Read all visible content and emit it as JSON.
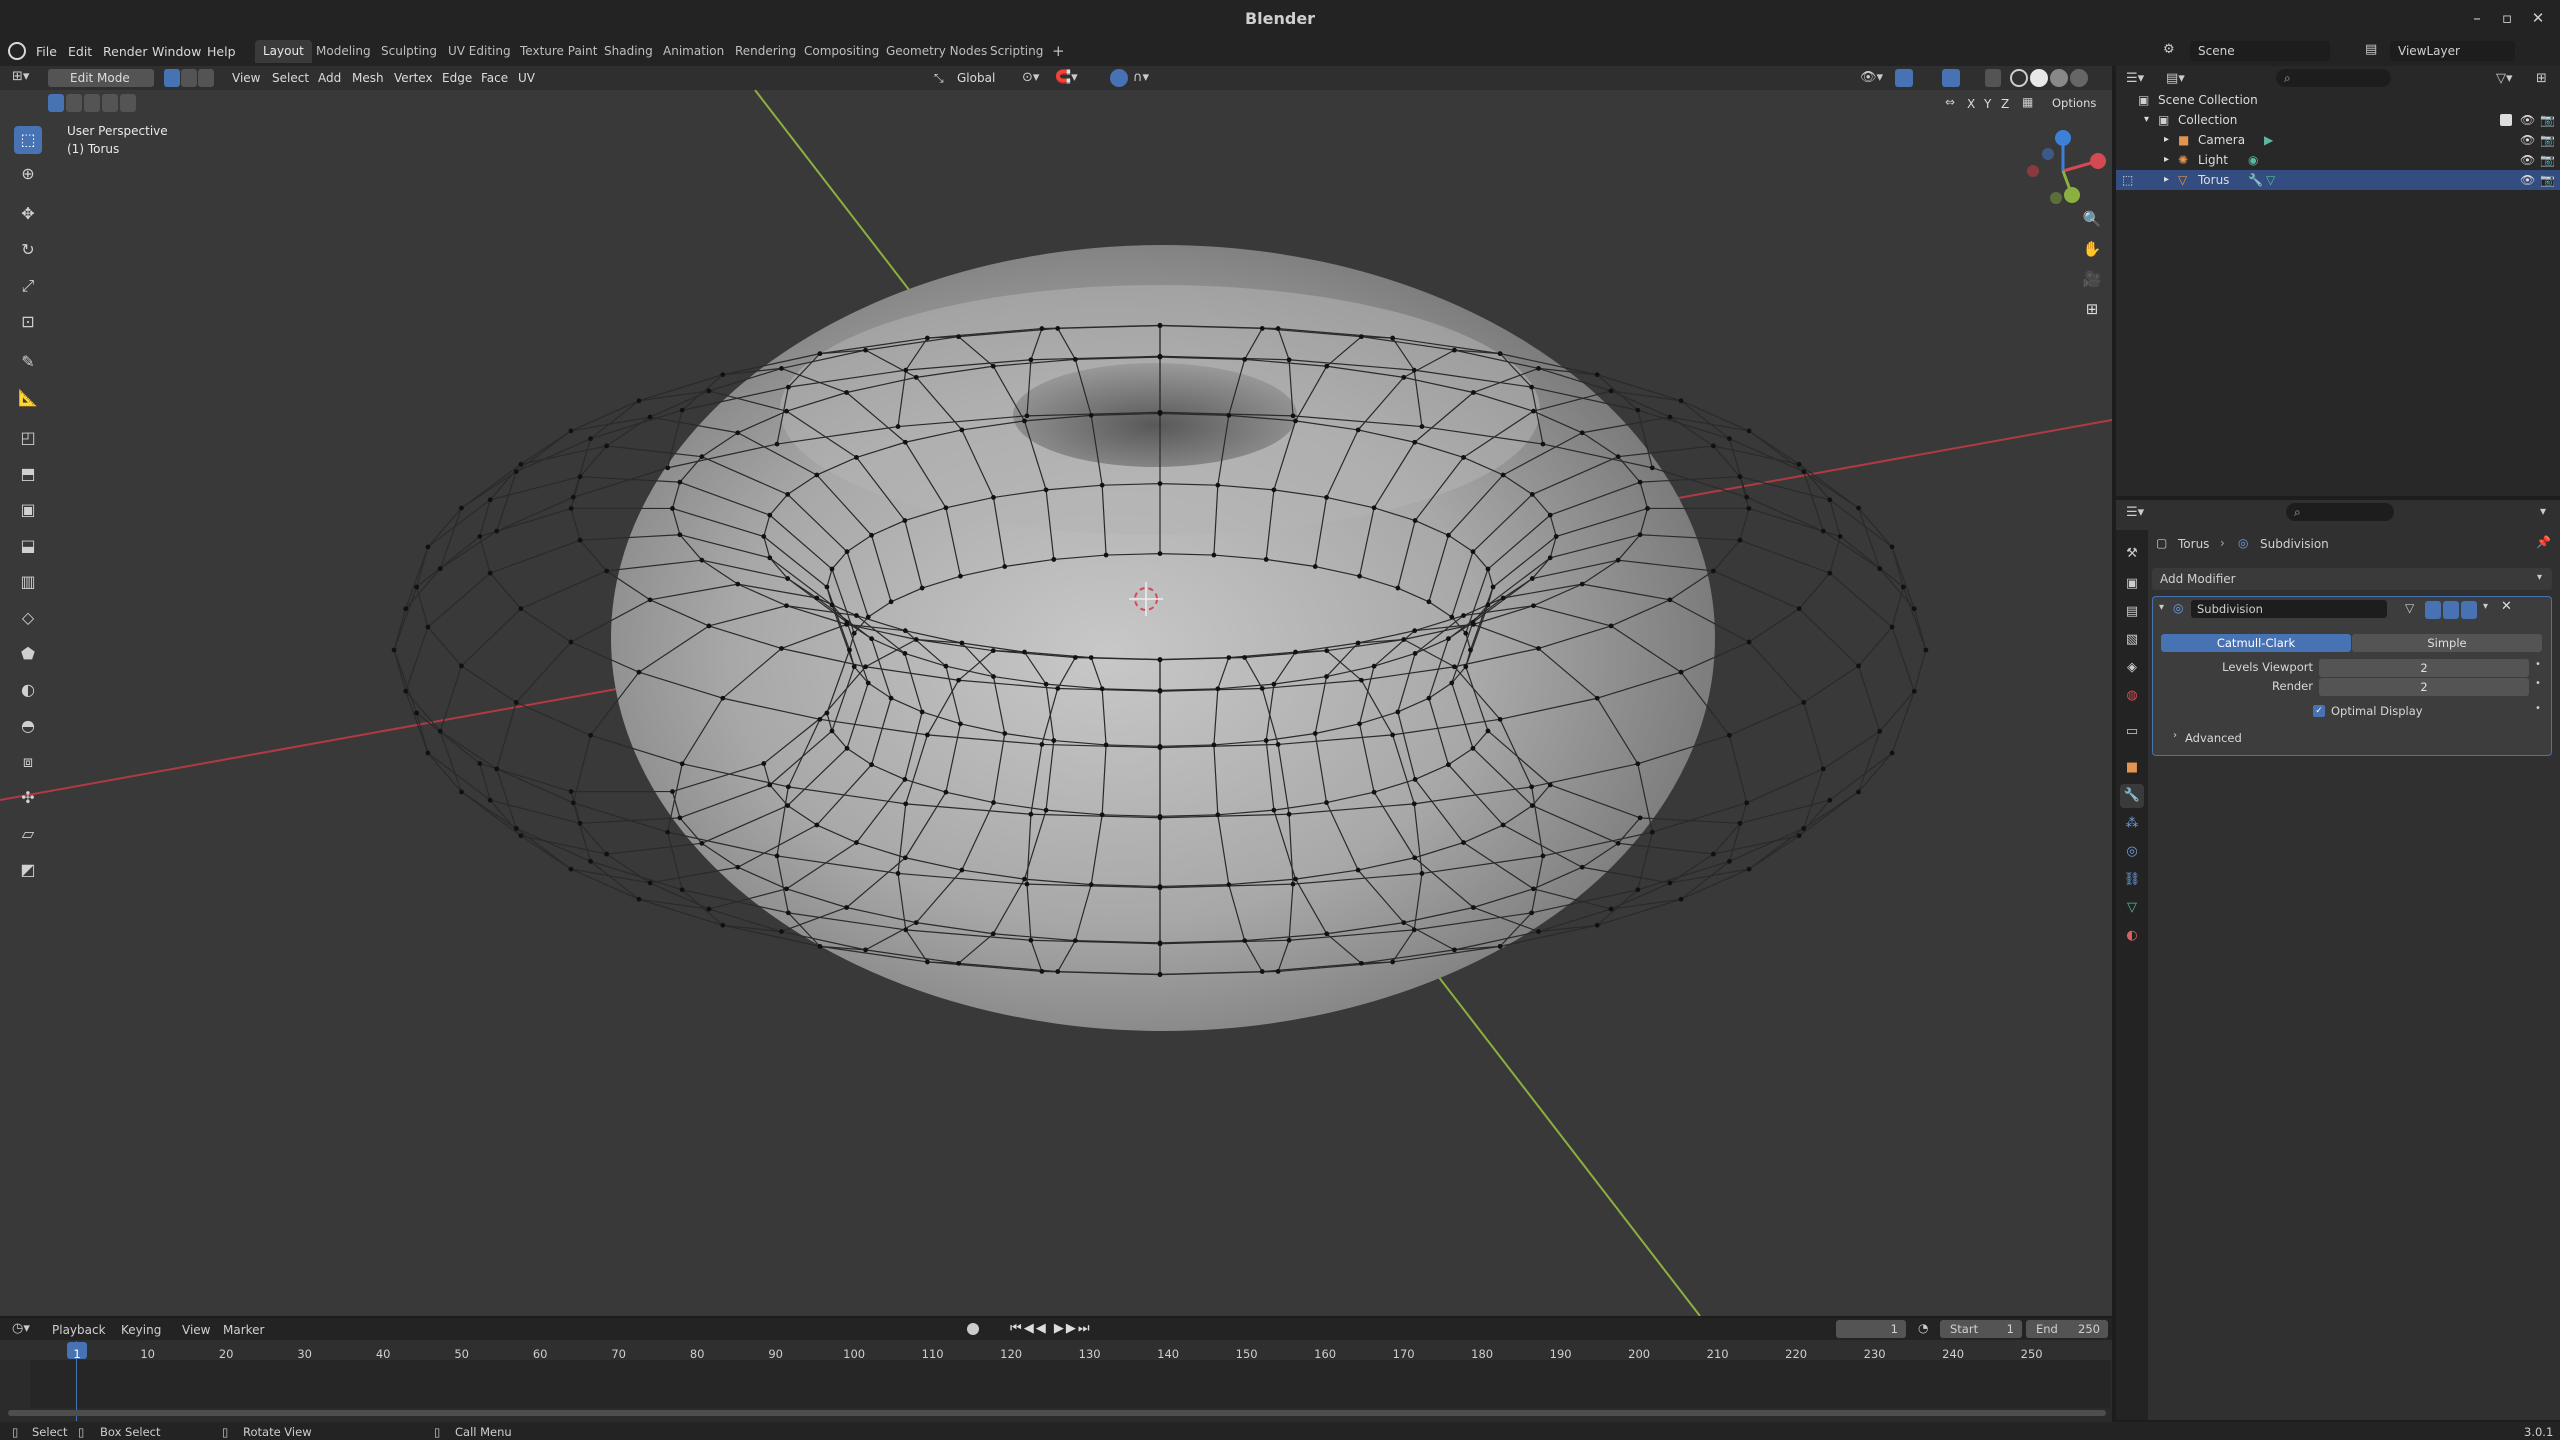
{
  "window": {
    "title": "Blender",
    "version": "3.0.1"
  },
  "menu": [
    "File",
    "Edit",
    "Render",
    "Window",
    "Help"
  ],
  "workspaces": [
    {
      "label": "Layout",
      "active": true
    },
    {
      "label": "Modeling"
    },
    {
      "label": "Sculpting"
    },
    {
      "label": "UV Editing"
    },
    {
      "label": "Texture Paint"
    },
    {
      "label": "Shading"
    },
    {
      "label": "Animation"
    },
    {
      "label": "Rendering"
    },
    {
      "label": "Compositing"
    },
    {
      "label": "Geometry Nodes"
    },
    {
      "label": "Scripting"
    }
  ],
  "scene": {
    "name": "Scene",
    "view_layer": "ViewLayer"
  },
  "viewport": {
    "mode": "Edit Mode",
    "menus": [
      "View",
      "Select",
      "Add",
      "Mesh",
      "Vertex",
      "Edge",
      "Face",
      "UV"
    ],
    "transform_orientation": "Global",
    "options_label": "Options",
    "axis_labels": {
      "x": "X",
      "y": "Y",
      "z": "Z"
    },
    "overlay_text": {
      "perspective": "User Perspective",
      "object": "(1) Torus"
    }
  },
  "outliner": {
    "root": "Scene Collection",
    "collection": "Collection",
    "items": [
      {
        "name": "Camera",
        "selected": false
      },
      {
        "name": "Light",
        "selected": false
      },
      {
        "name": "Torus",
        "selected": true
      }
    ]
  },
  "properties": {
    "breadcrumb": {
      "object": "Torus",
      "modifier": "Subdivision"
    },
    "add_modifier": "Add Modifier",
    "modifier": {
      "name": "Subdivision",
      "types": [
        {
          "label": "Catmull-Clark",
          "active": true
        },
        {
          "label": "Simple",
          "active": false
        }
      ],
      "levels_viewport_label": "Levels Viewport",
      "levels_viewport": "2",
      "render_label": "Render",
      "render": "2",
      "optimal_display_label": "Optimal Display",
      "optimal_display": true,
      "advanced_label": "Advanced"
    }
  },
  "timeline": {
    "menus": [
      "Playback",
      "Keying",
      "View",
      "Marker"
    ],
    "current_frame": "1",
    "start_label": "Start",
    "start": "1",
    "end_label": "End",
    "end": "250",
    "ruler": [
      "1",
      "10",
      "20",
      "30",
      "40",
      "50",
      "60",
      "70",
      "80",
      "90",
      "100",
      "110",
      "120",
      "130",
      "140",
      "150",
      "160",
      "170",
      "180",
      "190",
      "200",
      "210",
      "220",
      "230",
      "240",
      "250"
    ]
  },
  "statusbar": {
    "select": "Select",
    "box_select": "Box Select",
    "rotate_view": "Rotate View",
    "call_menu": "Call Menu"
  },
  "colors": {
    "accent": "#4772b3",
    "viewport_bg": "#393939",
    "x_axis": "#d44a52",
    "y_axis": "#8cb040",
    "z_axis": "#3d80d8"
  }
}
